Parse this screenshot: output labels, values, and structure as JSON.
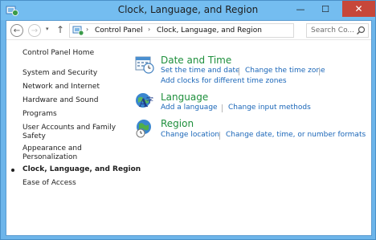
{
  "window": {
    "title": "Clock, Language, and Region",
    "close_glyph": "✕",
    "minimize_glyph": "—",
    "maximize_glyph": "☐"
  },
  "nav": {
    "back_glyph": "←",
    "forward_glyph": "→",
    "recent_glyph": "▾",
    "up_glyph": "↑"
  },
  "address": {
    "crumbs": [
      "Control Panel",
      "Clock, Language, and Region"
    ],
    "separator": "›",
    "dropdown_glyph": "▾",
    "refresh_glyph": "↻"
  },
  "search": {
    "placeholder": "Search Co..."
  },
  "sidebar": {
    "items": [
      {
        "label": "Control Panel Home"
      },
      {
        "label": "System and Security"
      },
      {
        "label": "Network and Internet"
      },
      {
        "label": "Hardware and Sound"
      },
      {
        "label": "Programs"
      },
      {
        "label": "User Accounts and Family",
        "label2": "Safety"
      },
      {
        "label": "Appearance and",
        "label2": "Personalization"
      },
      {
        "label": "Clock, Language, and Region",
        "current": true
      },
      {
        "label": "Ease of Access"
      }
    ]
  },
  "categories": [
    {
      "title": "Date and Time",
      "icon": "calendar-clock-icon",
      "links": [
        "Set the time and date",
        "Change the time zone",
        "Add clocks for different time zones"
      ]
    },
    {
      "title": "Language",
      "icon": "language-icon",
      "links": [
        "Add a language",
        "Change input methods"
      ]
    },
    {
      "title": "Region",
      "icon": "globe-clock-icon",
      "links": [
        "Change location",
        "Change date, time, or number formats"
      ]
    }
  ],
  "colors": {
    "title_bar": "#74bdf0",
    "close_button": "#c7473a",
    "category_title": "#1e8f3c",
    "link": "#1a66b8"
  }
}
